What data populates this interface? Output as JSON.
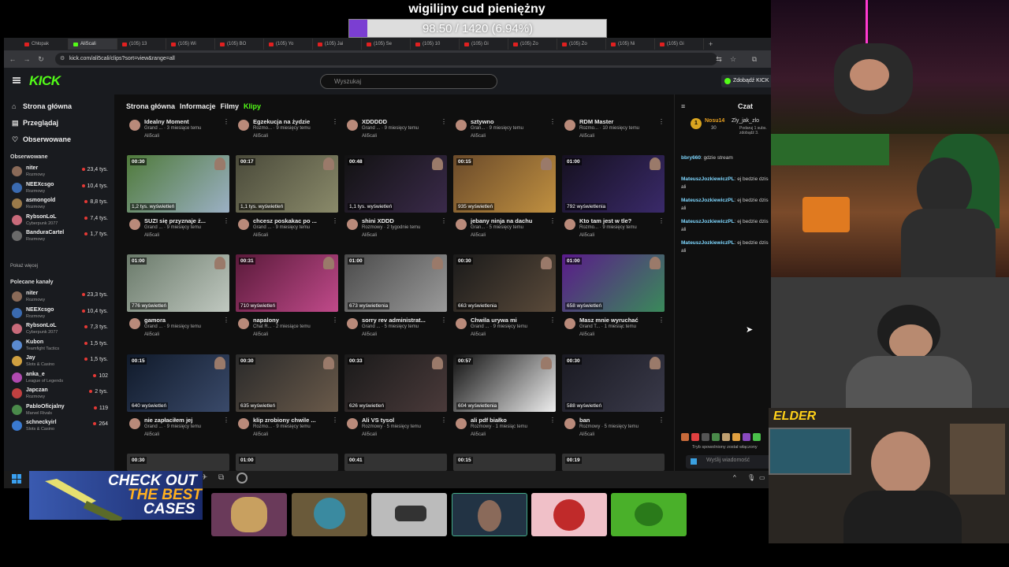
{
  "overlay": {
    "goal_title": "wigilijny cud pieniężny",
    "goal_text": "98.50 / 1420 (6.94%)",
    "goal_progress": 0.0694,
    "accent": "#7b3ed2",
    "promo_line1": "CHECK OUT",
    "promo_line2": "THE BEST",
    "promo_line3": "CASES",
    "cam_logo": "ELDER"
  },
  "browser": {
    "tabs": [
      "Chłopak",
      "AliScali",
      "(105) 13",
      "(105) Wi",
      "(105) BO",
      "(105) Yo",
      "(105) Jai",
      "(105) Se",
      "(105) 10",
      "(105) Gi",
      "(105) Zo",
      "(105) Zo",
      "(105) Ni",
      "(105) Gi"
    ],
    "url": "kick.com/ali5cali/clips?sort=view&range=all"
  },
  "kick": {
    "logo": "KICK",
    "search_placeholder": "Wyszukaj",
    "get_kick": "Zdobądź KICK",
    "sidebar": {
      "main": [
        {
          "icon": "home-icon",
          "glyph": "⌂",
          "label": "Strona główna"
        },
        {
          "icon": "browse-icon",
          "glyph": "▤",
          "label": "Przeglądaj"
        },
        {
          "icon": "heart-icon",
          "glyph": "♡",
          "label": "Obserwowane"
        }
      ],
      "followed_header": "Obserwowane",
      "followed": [
        {
          "name": "niter",
          "game": "Rozmowy",
          "viewers": "23,4 tys.",
          "color": "#8a6a58"
        },
        {
          "name": "NEEXcsgo",
          "game": "Rozmowy",
          "viewers": "10,4 tys.",
          "color": "#3a6ab0"
        },
        {
          "name": "asmongold",
          "game": "Rozmowy",
          "viewers": "8,8 tys.",
          "color": "#9a7a4a"
        },
        {
          "name": "RybsonLoL",
          "game": "Cyberpunk 2077",
          "viewers": "7,4 tys.",
          "color": "#c86a7a"
        },
        {
          "name": "BanduraCartel",
          "game": "Rozmowy",
          "viewers": "1,7 tys.",
          "color": "#6a6a6a"
        }
      ],
      "show_more": "Pokaż więcej",
      "recommended_header": "Polecane kanały",
      "recommended": [
        {
          "name": "niter",
          "game": "Rozmowy",
          "viewers": "23,3 tys.",
          "color": "#8a6a58"
        },
        {
          "name": "NEEXcsgo",
          "game": "Rozmowy",
          "viewers": "10,4 tys.",
          "color": "#3a6ab0"
        },
        {
          "name": "RybsonLoL",
          "game": "Cyberpunk 2077",
          "viewers": "7,3 tys.",
          "color": "#c86a7a"
        },
        {
          "name": "Kubon",
          "game": "Teamfight Tactics",
          "viewers": "1,5 tys.",
          "color": "#5a8ad0"
        },
        {
          "name": "Jay",
          "game": "Slots & Casino",
          "viewers": "1,5 tys.",
          "color": "#d0a040"
        },
        {
          "name": "anka_e",
          "game": "League of Legends",
          "viewers": "102",
          "color": "#b04ab0"
        },
        {
          "name": "Japczan",
          "game": "Rozmowy",
          "viewers": "2 tys.",
          "color": "#c04040"
        },
        {
          "name": "PabloOficjalny",
          "game": "Marvel Rivals",
          "viewers": "119",
          "color": "#4a8a4a"
        },
        {
          "name": "schneckyirl",
          "game": "Slots & Casino",
          "viewers": "264",
          "color": "#3a7ad0"
        }
      ]
    },
    "subnav": [
      "Strona główna",
      "Informacje",
      "Filmy",
      "Klipy"
    ],
    "clips_top_row": [
      {
        "title": "Idealny Moment",
        "sub": "Grand ... · 3 miesiące temu",
        "author": "Ali5cali"
      },
      {
        "title": "Egzekucja na żydzie",
        "sub": "Rozmo... · 9 miesięcy temu",
        "author": "Ali5cali"
      },
      {
        "title": "XDDDDD",
        "sub": "Grand ... · 9 miesięcy temu",
        "author": "Ali5cali"
      },
      {
        "title": "sztywno",
        "sub": "Gran... · 9 miesięcy temu",
        "author": "Ali5cali"
      },
      {
        "title": "RDM Master",
        "sub": "Rozmo... · 10 miesięcy temu",
        "author": "Ali5cali"
      }
    ],
    "clips": [
      {
        "dur": "00:30",
        "views": "1,2 tys. wyświetleń",
        "title": "SUZI się przyznaje ż...",
        "sub": "Grand ... · 9 miesięcy temu",
        "author": "Ali5cali",
        "bg": "#4f7a3a",
        "bg2": "#9bb0c4"
      },
      {
        "dur": "00:17",
        "views": "1,1 tys. wyświetleń",
        "title": "chcesz poskakac po ...",
        "sub": "Grand ... · 9 miesięcy temu",
        "author": "Ali5cali",
        "bg": "#4a4a3a",
        "bg2": "#8a8a6a"
      },
      {
        "dur": "00:48",
        "views": "1,1 tys. wyświetleń",
        "title": "shini XDDD",
        "sub": "Rozmowy · 2 tygodnie temu",
        "author": "Ali5cali",
        "bg": "#121212",
        "bg2": "#3a2a4a"
      },
      {
        "dur": "00:15",
        "views": "935 wyświetleń",
        "title": "jebany ninja na dachu",
        "sub": "Gran... · 5 miesięcy temu",
        "author": "Ali5cali",
        "bg": "#6a4a2a",
        "bg2": "#c09040"
      },
      {
        "dur": "01:00",
        "views": "792 wyświetlenia",
        "title": "Kto tam jest w tle?",
        "sub": "Rozmo... · 9 miesięcy temu",
        "author": "Ali5cali",
        "bg": "#15101f",
        "bg2": "#3a2a6a"
      },
      {
        "dur": "01:00",
        "views": "776 wyświetleń",
        "title": "gamora",
        "sub": "Grand ... · 9 miesięcy temu",
        "author": "Ali5cali",
        "bg": "#6a7a6a",
        "bg2": "#c0c8c0"
      },
      {
        "dur": "00:31",
        "views": "710 wyświetleń",
        "title": "napalony",
        "sub": "Chat R... · 2 miesiące temu",
        "author": "Ali5cali",
        "bg": "#5a1a3a",
        "bg2": "#c04a8a"
      },
      {
        "dur": "01:00",
        "views": "673 wyświetlenia",
        "title": "sorry rev administrat...",
        "sub": "Grand ... · 5 miesięcy temu",
        "author": "Ali5cali",
        "bg": "#4a4a4a",
        "bg2": "#9a9a9a"
      },
      {
        "dur": "00:30",
        "views": "663 wyświetlenia",
        "title": "Chwila urywa mi",
        "sub": "Grand ... · 9 miesięcy temu",
        "author": "Ali5cali",
        "bg": "#1a1a1a",
        "bg2": "#5a4a3a"
      },
      {
        "dur": "01:00",
        "views": "658 wyświetleń",
        "title": "Masz mnie wyruchać",
        "sub": "Grand T... · 1 miesiąc temu",
        "author": "Ali5cali",
        "bg": "#5a1a8a",
        "bg2": "#3a8a5a"
      },
      {
        "dur": "00:15",
        "views": "640 wyświetleń",
        "title": "nie zapłaciłem jej",
        "sub": "Grand ... · 9 miesięcy temu",
        "author": "Ali5cali",
        "bg": "#101a2a",
        "bg2": "#3a4a6a"
      },
      {
        "dur": "00:30",
        "views": "635 wyświetleń",
        "title": "klip zrobiony chwile ...",
        "sub": "Rozmo... · 9 miesięcy temu",
        "author": "Ali5cali",
        "bg": "#2a2a2a",
        "bg2": "#6a5a4a"
      },
      {
        "dur": "00:33",
        "views": "626 wyświetleń",
        "title": "Ali VS tysol",
        "sub": "Rozmowy · 5 miesięcy temu",
        "author": "Ali5cali",
        "bg": "#1a1a1a",
        "bg2": "#4a3a3a"
      },
      {
        "dur": "00:57",
        "views": "604 wyświetlenia",
        "title": "ali pdf białko",
        "sub": "Rozmowy · 1 miesiąc temu",
        "author": "Ali5cali",
        "bg": "#111",
        "bg2": "#eee"
      },
      {
        "dur": "00:30",
        "views": "588 wyświetleń",
        "title": "ban",
        "sub": "Rozmowy · 5 miesięcy temu",
        "author": "Ali5cali",
        "bg": "#1a1a22",
        "bg2": "#3a3a4a"
      }
    ],
    "bottom_durs": [
      "00:30",
      "01:00",
      "00:41",
      "00:15",
      "00:19"
    ],
    "chat": {
      "title": "Czat",
      "pinned_rank": "1",
      "pinned_user": "Nosu14",
      "pinned_amount": "30",
      "pinned_user2": "Zly_jak_zlo",
      "pinned_text": "Podaruj 1 subs. zdobądź 3.",
      "messages": [
        {
          "user": "bbry660",
          "text": "gdzie stream",
          "style": "u2"
        },
        {
          "user": "MateuszJozkiewiczPL",
          "text": "ej bedzie dzis ali",
          "style": "u2"
        },
        {
          "user": "MateuszJozkiewiczPL",
          "text": "ej bedzie dzis ali",
          "style": "u2"
        },
        {
          "user": "MateuszJozkiewiczPL",
          "text": "ej bedzie dzis ali",
          "style": "u2"
        },
        {
          "user": "MateuszJozkiewiczPL",
          "text": "ej bedzie dzis ali",
          "style": "u2"
        }
      ],
      "slow_mode": "Tryb spowolniony został włączony",
      "input_placeholder": "Wyślij wiadomość",
      "points": "0"
    }
  }
}
